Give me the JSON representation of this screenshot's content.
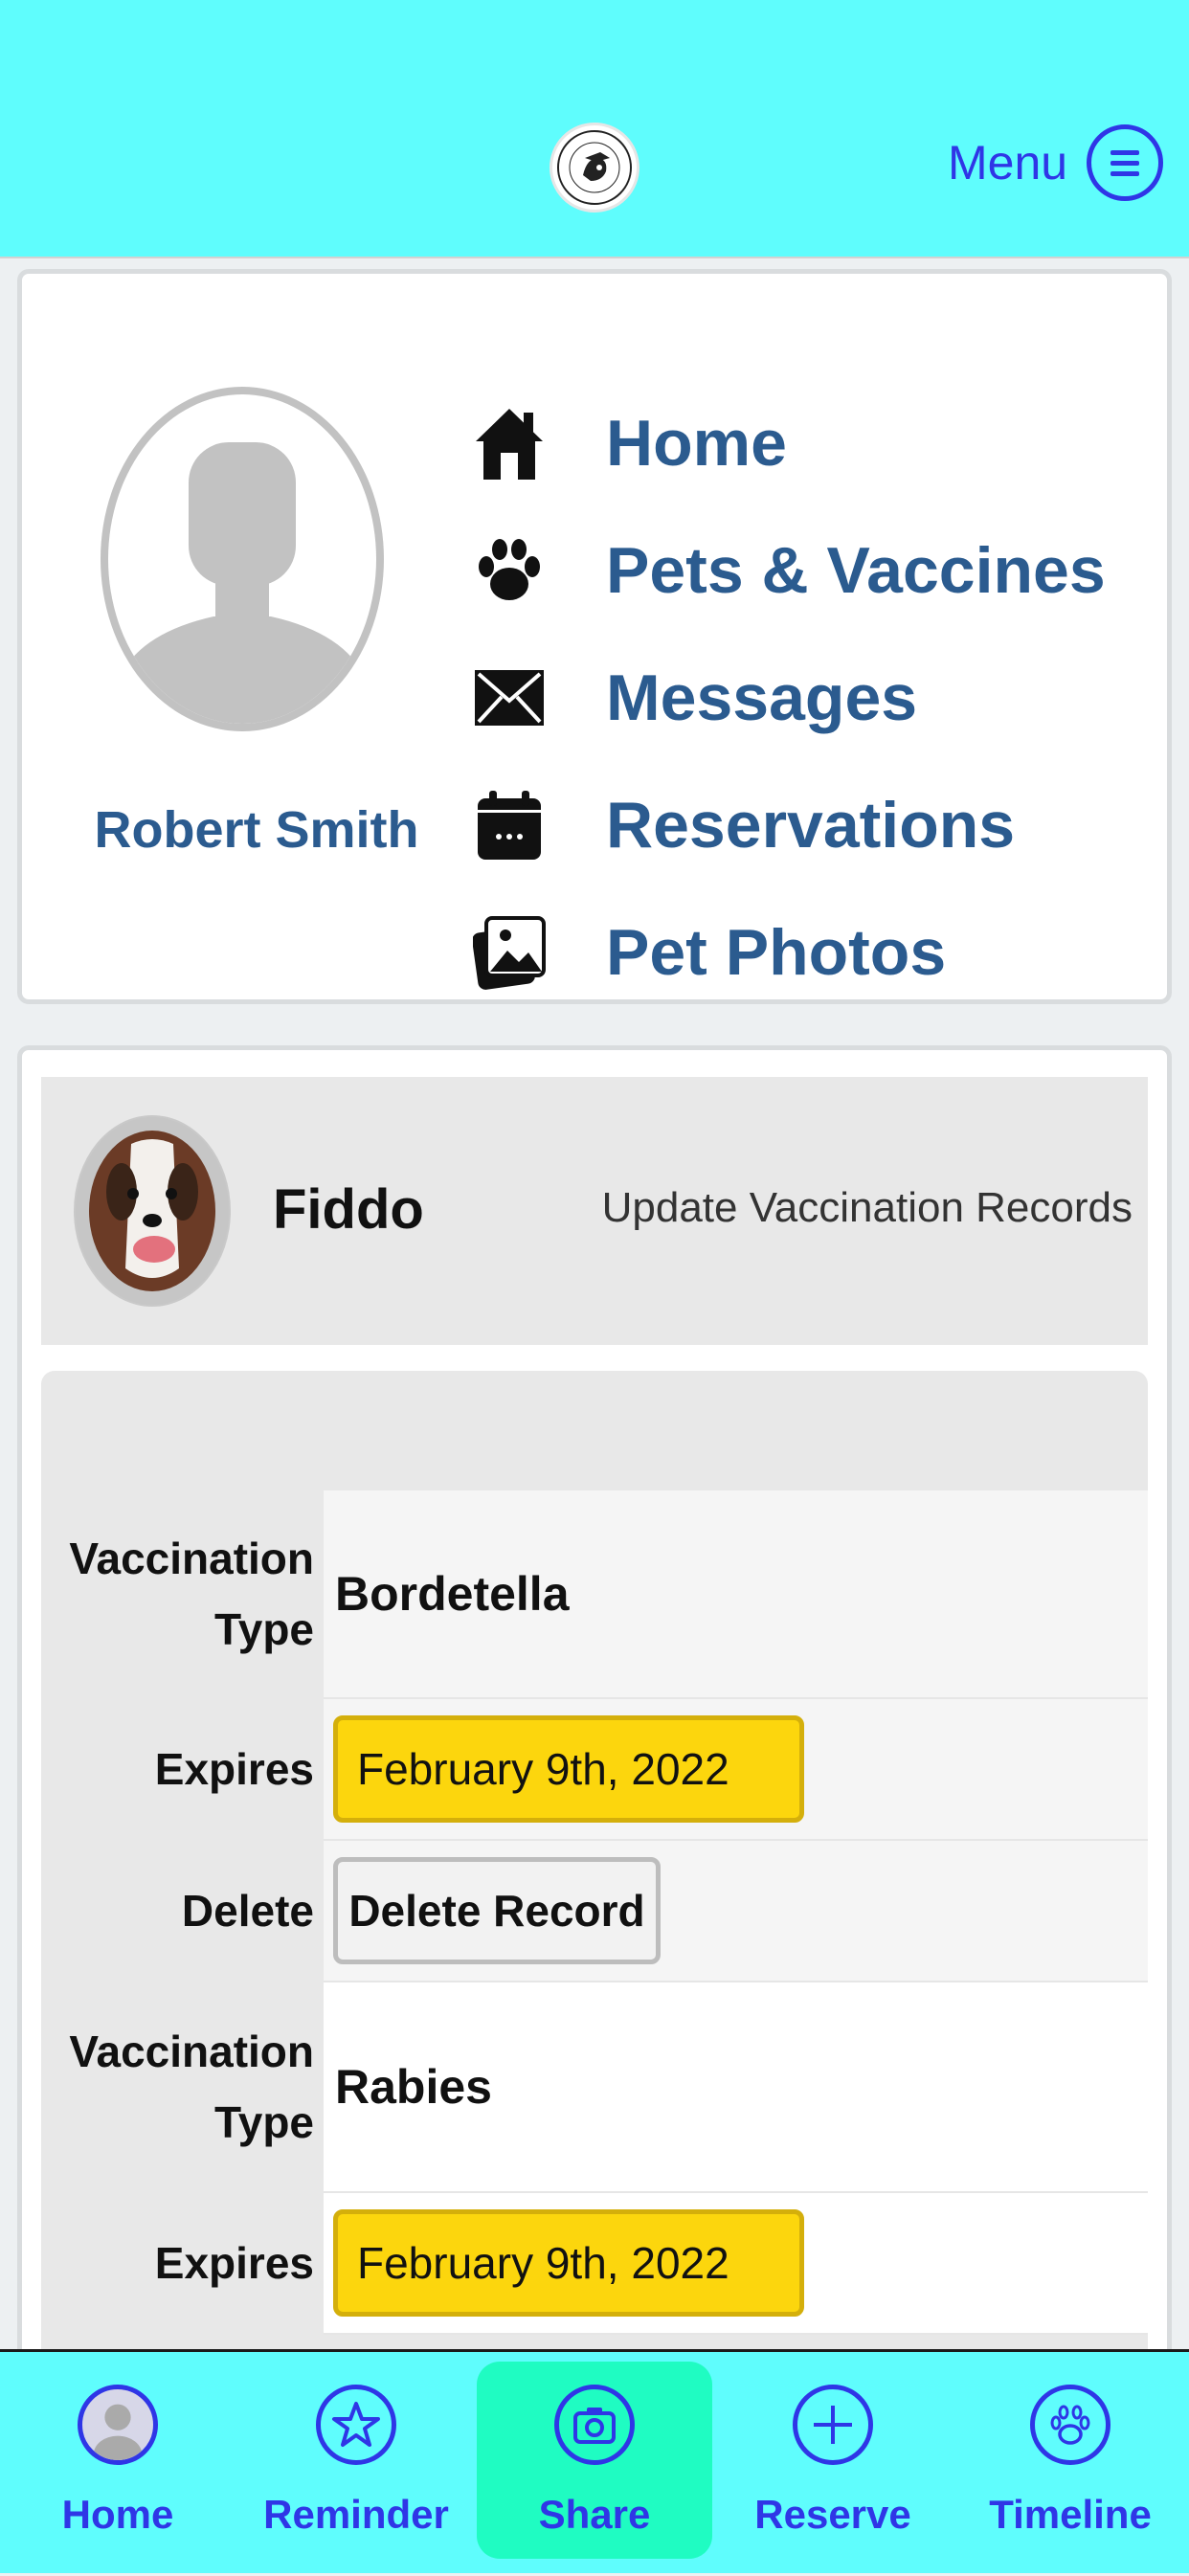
{
  "header": {
    "menu_label": "Menu"
  },
  "profile": {
    "name": "Robert Smith",
    "nav": [
      {
        "label": "Home",
        "icon": "home-icon"
      },
      {
        "label": "Pets & Vaccines",
        "icon": "paw-icon"
      },
      {
        "label": "Messages",
        "icon": "envelope-icon"
      },
      {
        "label": "Reservations",
        "icon": "calendar-icon"
      },
      {
        "label": "Pet Photos",
        "icon": "photos-icon"
      }
    ]
  },
  "pet": {
    "name": "Fiddo",
    "update_link": "Update Vaccination Records"
  },
  "records": {
    "type_label": "Vaccination Type",
    "expires_label": "Expires",
    "delete_label": "Delete",
    "delete_button": "Delete Record",
    "items": [
      {
        "type": "Bordetella",
        "expires": "February 9th, 2022"
      },
      {
        "type": "Rabies",
        "expires": "February 9th, 2022"
      }
    ]
  },
  "tabbar": [
    {
      "label": "Home",
      "icon": "user-icon"
    },
    {
      "label": "Reminder",
      "icon": "star-icon"
    },
    {
      "label": "Share",
      "icon": "camera-icon"
    },
    {
      "label": "Reserve",
      "icon": "plus-icon"
    },
    {
      "label": "Timeline",
      "icon": "paw-icon"
    }
  ],
  "colors": {
    "header_bg": "#5ffdfd",
    "accent_blue": "#2f36e6",
    "nav_text": "#2b5b8f",
    "date_button": "#fcd60d",
    "share_tab_bg": "#1ffcc2"
  }
}
